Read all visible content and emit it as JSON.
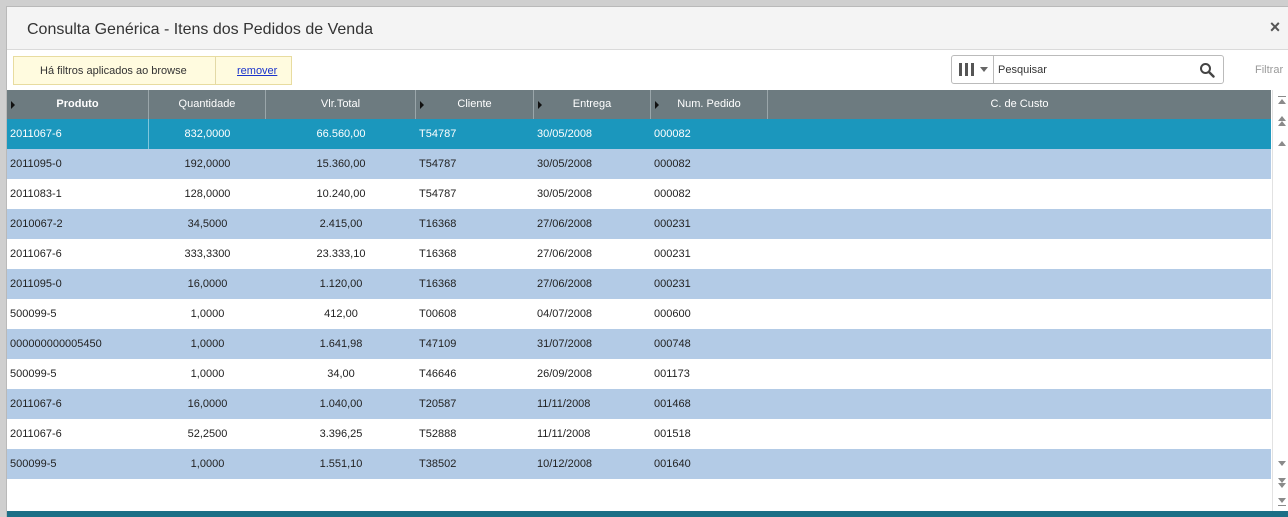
{
  "window": {
    "title": "Consulta Genérica - Itens dos Pedidos de Venda",
    "close_label": "×"
  },
  "filter": {
    "notice": "Há filtros aplicados ao browse",
    "remove_link": "remover"
  },
  "search": {
    "placeholder": "Pesquisar",
    "icon": "magnifier-icon",
    "columns_icon": "columns-icon",
    "filter_button": "Filtrar"
  },
  "grid": {
    "columns": [
      {
        "label": "Produto",
        "sortable": true
      },
      {
        "label": "Quantidade",
        "sortable": false
      },
      {
        "label": "Vlr.Total",
        "sortable": false
      },
      {
        "label": "Cliente",
        "sortable": true
      },
      {
        "label": "Entrega",
        "sortable": true
      },
      {
        "label": "Num. Pedido",
        "sortable": true
      },
      {
        "label": "C. de Custo",
        "sortable": false
      }
    ],
    "rows": [
      [
        "2011067-6",
        "832,0000",
        "66.560,00",
        "T54787",
        "30/05/2008",
        "000082",
        ""
      ],
      [
        "2011095-0",
        "192,0000",
        "15.360,00",
        "T54787",
        "30/05/2008",
        "000082",
        ""
      ],
      [
        "2011083-1",
        "128,0000",
        "10.240,00",
        "T54787",
        "30/05/2008",
        "000082",
        ""
      ],
      [
        "2010067-2",
        "34,5000",
        "2.415,00",
        "T16368",
        "27/06/2008",
        "000231",
        ""
      ],
      [
        "2011067-6",
        "333,3300",
        "23.333,10",
        "T16368",
        "27/06/2008",
        "000231",
        ""
      ],
      [
        "2011095-0",
        "16,0000",
        "1.120,00",
        "T16368",
        "27/06/2008",
        "000231",
        ""
      ],
      [
        "500099-5",
        "1,0000",
        "412,00",
        "T00608",
        "04/07/2008",
        "000600",
        ""
      ],
      [
        "000000000005450",
        "1,0000",
        "1.641,98",
        "T47109",
        "31/07/2008",
        "000748",
        ""
      ],
      [
        "500099-5",
        "1,0000",
        "34,00",
        "T46646",
        "26/09/2008",
        "001173",
        ""
      ],
      [
        "2011067-6",
        "16,0000",
        "1.040,00",
        "T20587",
        "11/11/2008",
        "001468",
        ""
      ],
      [
        "2011067-6",
        "52,2500",
        "3.396,25",
        "T52888",
        "11/11/2008",
        "001518",
        ""
      ],
      [
        "500099-5",
        "1,0000",
        "1.551,10",
        "T38502",
        "10/12/2008",
        "001640",
        ""
      ]
    ],
    "selected_row": 0
  },
  "colors": {
    "header": "#6d7b80",
    "selected": "#1b97bd",
    "alt_row": "#b3cbe6",
    "bottom_bar": "#1b6f86"
  }
}
